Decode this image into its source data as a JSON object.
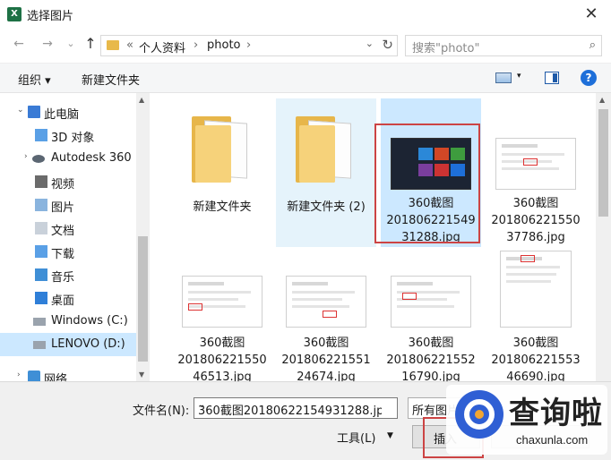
{
  "window": {
    "title": "选择图片",
    "close": "✕"
  },
  "nav": {
    "back": "←",
    "forward": "→",
    "recent": "⌄",
    "up": "↑",
    "crumb_sep": "«",
    "crumbs": [
      "个人资料",
      "photo"
    ],
    "crumb_arrow": "›",
    "dropdown": "⌄",
    "refresh": "↻",
    "search_placeholder": "搜索\"photo\"",
    "search_icon": "⌕"
  },
  "toolbar": {
    "organize": "组织 ▾",
    "new_folder": "新建文件夹",
    "view_drop": "▾",
    "help": "?"
  },
  "sidebar": {
    "items": [
      {
        "label": "此电脑",
        "icon": "pc-icon"
      },
      {
        "label": "3D 对象",
        "icon": "folder-3d-icon"
      },
      {
        "label": "Autodesk 360",
        "icon": "autodesk-icon"
      },
      {
        "label": "视频",
        "icon": "video-icon"
      },
      {
        "label": "图片",
        "icon": "pictures-icon"
      },
      {
        "label": "文档",
        "icon": "documents-icon"
      },
      {
        "label": "下载",
        "icon": "downloads-icon"
      },
      {
        "label": "音乐",
        "icon": "music-icon"
      },
      {
        "label": "桌面",
        "icon": "desktop-icon"
      },
      {
        "label": "Windows (C:)",
        "icon": "drive-icon"
      },
      {
        "label": "LENOVO (D:)",
        "icon": "drive-icon"
      },
      {
        "label": "网络",
        "icon": "network-icon"
      }
    ],
    "caret_open": "⌄",
    "caret_closed": "›",
    "scroll_up": "▲",
    "scroll_down": "▼"
  },
  "files": [
    {
      "name": [
        "新建文件夹"
      ],
      "kind": "folder",
      "state": "normal"
    },
    {
      "name": [
        "新建文件夹 (2)"
      ],
      "kind": "folder",
      "state": "hover"
    },
    {
      "name": [
        "360截图",
        "201806221549",
        "31288.jpg"
      ],
      "kind": "dark-image",
      "state": "selected"
    },
    {
      "name": [
        "360截图",
        "201806221550",
        "37786.jpg"
      ],
      "kind": "image",
      "state": "normal"
    },
    {
      "name": [
        "360截图",
        "201806221550",
        "46513.jpg"
      ],
      "kind": "image",
      "state": "normal"
    },
    {
      "name": [
        "360截图",
        "201806221551",
        "24674.jpg"
      ],
      "kind": "image",
      "state": "normal"
    },
    {
      "name": [
        "360截图",
        "201806221552",
        "16790.jpg"
      ],
      "kind": "image",
      "state": "normal"
    },
    {
      "name": [
        "360截图",
        "201806221553",
        "46690.jpg"
      ],
      "kind": "image",
      "state": "normal"
    }
  ],
  "bottom": {
    "filename_label": "文件名(N):",
    "filename_value": "360截图20180622154931288.jpg",
    "filename_drop": "⌄",
    "filetype_value": "所有图片",
    "tools": "工具(L)",
    "tools_drop": "▼",
    "insert": "插入"
  },
  "watermark": {
    "text": "查询啦",
    "url": "chaxunla.com"
  },
  "colors": {
    "selection": "#cce8ff",
    "hover": "#e5f3fb",
    "highlight_box": "#cc4444",
    "folder": "#e8b94a"
  }
}
